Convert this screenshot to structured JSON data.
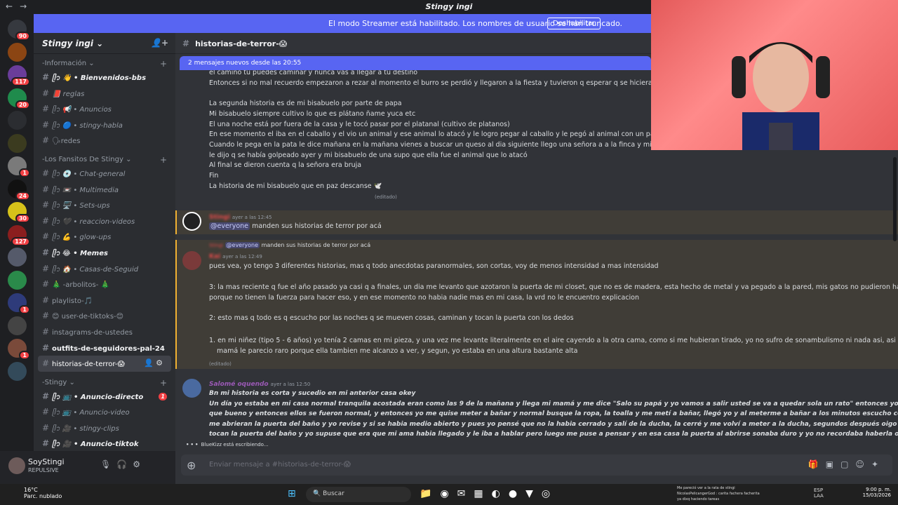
{
  "window": {
    "title": "Stingy ingi",
    "nav": [
      "←",
      "→"
    ]
  },
  "streamer_bar": {
    "text": "El modo Streamer está habilitado. Los nombres de usuario se han truncado.",
    "button": "Deshabilitar"
  },
  "servers": [
    {
      "color": "#36393f",
      "badge": "90"
    },
    {
      "color": "#8b4513",
      "badge": ""
    },
    {
      "color": "#6a3d9a",
      "badge": "117"
    },
    {
      "color": "#1f8b4c",
      "badge": "20"
    },
    {
      "color": "#2b2d31",
      "badge": ""
    },
    {
      "color": "#3b3b1f",
      "badge": ""
    },
    {
      "color": "#7a7a7a",
      "badge": "1"
    },
    {
      "color": "#111111",
      "badge": "24"
    },
    {
      "color": "#d6c21a",
      "badge": "30"
    },
    {
      "color": "#8b1e1e",
      "badge": "127"
    },
    {
      "color": "#555a6a",
      "badge": ""
    },
    {
      "color": "#2a8a4a",
      "badge": ""
    },
    {
      "color": "#2e3b7a",
      "badge": "1"
    },
    {
      "color": "#444444",
      "badge": ""
    },
    {
      "color": "#7a4a3a",
      "badge": "1"
    },
    {
      "color": "#334a5a",
      "badge": ""
    }
  ],
  "server": {
    "name": "Stingy ingi",
    "categories": [
      {
        "name": "-Información",
        "channels": [
          {
            "label": "ᥫ᭡ 👋 • Bienvenidos-bbs",
            "style": "unread italic"
          },
          {
            "label": "📕 reglas",
            "style": "italic"
          },
          {
            "label": "ᥫ᭡ 📢 • Anuncios",
            "style": "italic"
          },
          {
            "label": "ᥫ᭡ 🔵 • stingy-habla",
            "style": "italic"
          },
          {
            "label": "🗣redes",
            "style": ""
          }
        ]
      },
      {
        "name": "-Los Fansitos De Stingy",
        "channels": [
          {
            "label": "ᥫ᭡ 💿 • Chat-general",
            "style": "italic"
          },
          {
            "label": "ᥫ᭡ 📼 • Multimedia",
            "style": "italic"
          },
          {
            "label": "ᥫ᭡ 🖥️ • Sets-ups",
            "style": "italic"
          },
          {
            "label": "ᥫ᭡ 🖤 • reaccion-videos",
            "style": "italic"
          },
          {
            "label": "ᥫ᭡ 💪 • glow-ups",
            "style": "italic"
          },
          {
            "label": "ᥫ᭡ 😂 • Memes",
            "style": "unread italic"
          },
          {
            "label": "ᥫ᭡ 🏠 • Casas-de-Seguid",
            "style": "italic"
          },
          {
            "label": "🎄 -arbolitos- 🎄",
            "style": ""
          },
          {
            "label": "playlisto-🎵",
            "style": ""
          },
          {
            "label": "😊 user-de-tiktoks-😊",
            "style": ""
          },
          {
            "label": "instagrams-de-ustedes",
            "style": ""
          },
          {
            "label": "outfits-de-seguidores-pal-24",
            "style": "unread"
          },
          {
            "label": "historias-de-terror-😱",
            "style": "active"
          }
        ]
      },
      {
        "name": "-Stingy",
        "channels": [
          {
            "label": "ᥫ᭡ 📺 • Anuncio-directo",
            "style": "unread italic",
            "badge": "1"
          },
          {
            "label": "ᥫ᭡ 📺 • Anuncio-video",
            "style": "italic"
          },
          {
            "label": "ᥫ᭡ 🎥 • stingy-clips",
            "style": "italic"
          },
          {
            "label": "ᥫ᭡ 🎥 • Anuncio-tiktok",
            "style": "unread italic"
          }
        ]
      }
    ]
  },
  "user": {
    "name": "SoyStingi",
    "status": "REPULSIVE"
  },
  "chat": {
    "channel": "historias-de-terror-😱",
    "new_messages": "2 mensajes nuevos desde las 20:55",
    "lines_top": [
      "el camino tu puedes caminar  y nunca vas a llegar a tu destino",
      "Entonces si no mal recuerdo empezaron a rezar al momento el burro se perdió y llegaron a la fiesta y tuvieron q esperar q se hiciera de día p",
      "",
      "La segunda historia es de mi bisabuelo por parte de papa",
      "Mi bisabuelo siempre cultivo lo que es plátano ñame yuca etc",
      "El una noche está por fuera de la casa y le tocó pasar por el platanal (cultivo de platanos)",
      "En ese momento el iba en el caballo y el vio un animal y ese animal lo atacó y le logro pegar al caballo y le pegó al   animal con un palo q siem",
      "Cuando le pega en la pata le dice mañana en la mañana vienes a buscar un queso al dia siguiente llego una señora a a la finca y mi bisabuelo vio q la señora tenía la mano vendada y le pregunto por q la tenía Haci y",
      "le dijo q se había  golpeado ayer y mi  bisabuelo  de una supo que ella fue el animal que lo atacó",
      "Al final  se dieron cuenta q la señora era bruja",
      "Fin",
      "La historia de mi bisabuelo que en paz descanse 🕊️"
    ],
    "edited": "(editado)",
    "msg_stingi": {
      "author": "Stingi",
      "time": "ayer a las 12:45",
      "mention": "@everyone",
      "text": "manden sus historias de terror por acá"
    },
    "msg_kai": {
      "reply_author": "Stingi",
      "reply_mention": "@everyone",
      "reply_text": "manden sus historias de terror por acá",
      "author": "Kai",
      "time": "ayer a las 12:49",
      "lines": [
        "pues vea, yo tengo 3 diferentes historias, mas q todo anecdotas paranormales, son cortas, voy de menos intensidad a mas intensidad",
        "3: la mas reciente q fue el año pasado ya casi q a finales, un dia me levanto que azotaron la puerta de mi closet, que no es de madera, esta hecho de metal y va pegado a la pared, mis gatos no pudieron haber sido",
        "porque no tienen la fuerza para hacer eso, y en ese momento no habia nadie mas en mi casa, la vrd no le encuentro explicacion",
        "2: esto mas q todo es q escucho por las noches q se mueven cosas, caminan y tocan la puerta con los dedos",
        "1. en mi niñez (tipo 5 - 6 años) yo tenía 2 camas en mi pieza, y una vez me levante literalmente en el aire cayendo a la otra cama, como si me hubieran tirado, yo no sufro de sonambulismo ni nada asi, asi que a mi",
        "mamá le parecio raro porque ella tambien me alcanzo a ver, y segun, yo estaba en una altura bastante alta"
      ]
    },
    "msg_salome": {
      "author": "Salomé oquendo",
      "time": "ayer a las 12:50",
      "lines": [
        "Bn mi historia es corta y sucedio en mi anterior casa okey",
        "Un día yo estaba en mi casa normal tranquila acostada eran como las 9 de la mañana y llega mi mamá y me dice \"Salo su papá y yo vamos a salir usted se va a quedar sola un rato\" entonces yo dije",
        "que bueno y entonces ellos se fueron normal, y entonces yo me quise meter a bañar y normal busque la ropa, la toalla y me metí a bañar, llegó yo y al meterme a bañar a los minutos escucho como si",
        "me abrieran la puerta del baño y yo revise y si se habia medio abierto y pues yo pensé que no la habia cerrado y salí de la ducha, la cerré y me volví a meter a la ducha, segundos después oigo que",
        "tocan la puerta del baño y yo supuse que era que mi ama habia llegado y le iba a hablar pero luego me puse a pensar y en esa casa la puerta al abrirse sonaba duro y yo no recordaba haberla oido"
      ]
    },
    "typing": "BlueKizz está escribiendo...",
    "composer_placeholder": "Enviar mensaje a #historias-de-terror-😱"
  },
  "taskbar": {
    "temp": "16°C",
    "weather": "Parc. nublado",
    "search": "Buscar",
    "lang": "ESP",
    "lang2": "LAA",
    "time": "9:00 p. m.",
    "date": "15/03/2026",
    "chat_lines": [
      "Me pareció ver a la rata de stingi",
      "NicolasPelicangerGod : carita fachera facherita",
      "ya dixq haciendo tareas"
    ]
  }
}
